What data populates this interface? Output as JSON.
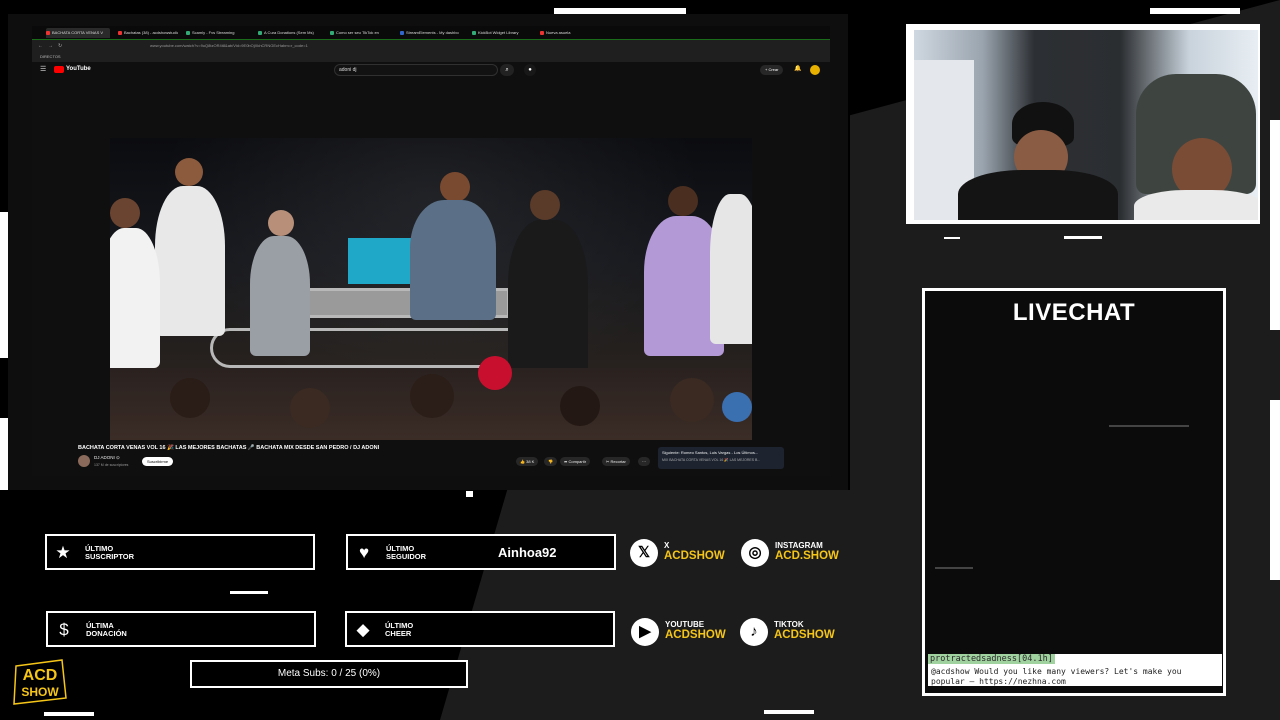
{
  "browser": {
    "tabs": [
      {
        "label": "BACHATA CORTA VENAS V"
      },
      {
        "label": "Bachatas (38) - acdshowstudio"
      },
      {
        "label": "Scamly - Fvs Streaming"
      },
      {
        "label": "A Cura Donations (Sem Ms)"
      },
      {
        "label": "Como ser seu TikTok en"
      },
      {
        "label": "StreamElements - My dashbo"
      },
      {
        "label": "KickBot Widget Library"
      },
      {
        "label": "Nueva asuela"
      }
    ],
    "url": "www.youtube.com/watch?v=9uQ8tzOR4t8&ab/Vid=9E0bOjXkhCRNGEcHabm=r_code=1",
    "bookmarks_folder": "DIRECTOS"
  },
  "youtube": {
    "brand": "YouTube",
    "search_query": "adoni dj",
    "create_label": "+ Crear",
    "video_title": "BACHATA CORTA VENAS VOL 16 🎉 LAS MEJORES BACHATAS 🎤 BACHATA MIX DESDE SAN PEDRO / DJ ADONI",
    "channel_name": "DJ ADONI ⊙",
    "channel_subs": "137 M de suscriptores",
    "subscribe_label": "Suscribirme",
    "likes": "👍 38 K",
    "dislike": "👎",
    "share_label": "➦ Compartir",
    "clip_label": "✂ Recortar",
    "more_label": "···",
    "next_title": "Siguiente: Romeo Santos, Luis Vargas - Los Últimos...",
    "next_sub": "MIX BACHATA CORTA VENAS VOL 16 🎉 LAS MEJORES B..."
  },
  "chat": {
    "title": "LIVECHAT",
    "username": "protractedsadness[04.1h]",
    "message": "@acdshow Would you like many viewers? Let's make you popular — https://nezhna.com"
  },
  "alerts": {
    "subscriber": {
      "label_1": "ÚLTIMO",
      "label_2": "SUSCRIPTOR",
      "value": "",
      "icon": "star-icon"
    },
    "follower": {
      "label_1": "ÚLTIMO",
      "label_2": "SEGUIDOR",
      "value": "Ainhoa92",
      "icon": "heart-icon"
    },
    "donation": {
      "label_1": "ÚLTIMA",
      "label_2": "DONACIÓN",
      "value": "",
      "icon": "dollar-icon"
    },
    "cheer": {
      "label_1": "ÚLTIMO",
      "label_2": "CHEER",
      "value": "",
      "icon": "diamond-icon"
    }
  },
  "socials": [
    {
      "platform": "X",
      "handle": "ACDSHOW",
      "icon": "x-logo-icon"
    },
    {
      "platform": "INSTAGRAM",
      "handle": "ACD.SHOW",
      "icon": "instagram-icon"
    },
    {
      "platform": "YOUTUBE",
      "handle": "ACDSHOW",
      "icon": "youtube-icon"
    },
    {
      "platform": "TIKTOK",
      "handle": "ACDSHOW",
      "icon": "tiktok-icon"
    }
  ],
  "meta": {
    "text": "Meta Subs:  0 / 25 (0%)",
    "current": 0,
    "goal": 25
  },
  "logo": {
    "line1": "ACD",
    "line2": "SHOW"
  },
  "colors": {
    "accent_yellow": "#f5c518",
    "background": "#000000",
    "panel": "#1c1c1c"
  }
}
